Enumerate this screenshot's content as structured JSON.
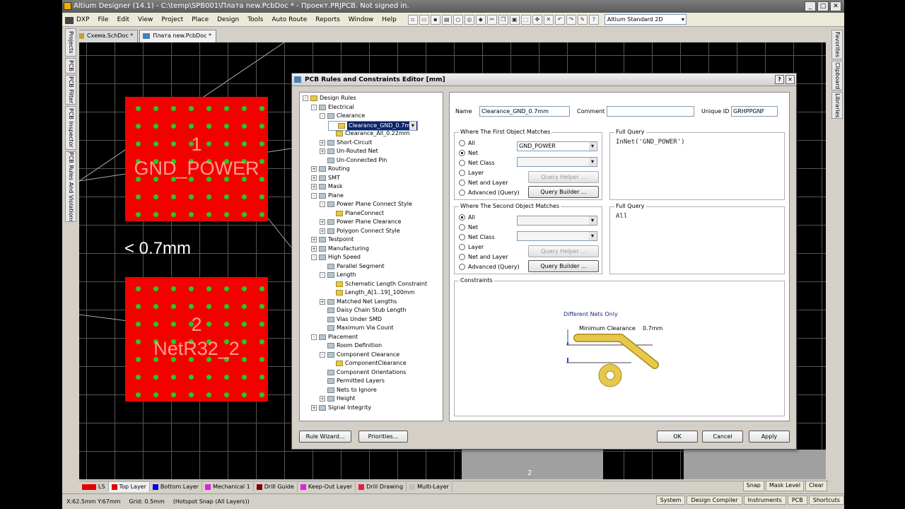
{
  "window": {
    "title": "Altium Designer (14.1) - C:\\temp\\SPB001\\Плата new.PcbDoc * - Проект.PRJPCB. Not signed in.",
    "min": "_",
    "max": "□",
    "close": "✕"
  },
  "menu": [
    "DXP",
    "File",
    "Edit",
    "View",
    "Project",
    "Place",
    "Design",
    "Tools",
    "Auto Route",
    "Reports",
    "Window",
    "Help"
  ],
  "view_select": "Altium Standard 2D",
  "doc_tabs": [
    "Схема.SchDoc *",
    "Плата new.PcbDoc *"
  ],
  "left_panels": [
    "Projects",
    "PCB",
    "PCB Filter",
    "PCB Inspector",
    "PCB Rules And Violations"
  ],
  "right_panels": [
    "Favorites",
    "Clipboard",
    "Libraries"
  ],
  "canvas": {
    "pad1_num": "1",
    "pad1_net": "GND_POWER",
    "pad2_num": "2",
    "pad2_net": "NetR32_2",
    "dim_text": "< 0.7mm",
    "bottom_num": "2"
  },
  "layers": [
    {
      "name": "LS",
      "color": "#e00000"
    },
    {
      "name": "Top Layer",
      "color": "#e00000"
    },
    {
      "name": "Bottom Layer",
      "color": "#0000e0"
    },
    {
      "name": "Mechanical 1",
      "color": "#e020e0"
    },
    {
      "name": "Drill Guide",
      "color": "#800000"
    },
    {
      "name": "Keep-Out Layer",
      "color": "#e020e0"
    },
    {
      "name": "Drill Drawing",
      "color": "#e02040"
    },
    {
      "name": "Multi-Layer",
      "color": "#c0c0c0"
    }
  ],
  "snap": {
    "snap": "Snap",
    "mask": "Mask Level",
    "clear": "Clear"
  },
  "status": {
    "coords": "X:62.5mm Y:67mm",
    "grid": "Grid: 0.5mm",
    "hotspot": "(Hotspot Snap (All Layers))",
    "buttons": [
      "System",
      "Design Compiler",
      "Instruments",
      "PCB",
      "Shortcuts"
    ]
  },
  "dialog": {
    "title": "PCB Rules and Constraints Editor [mm]",
    "help": "?",
    "close": "✕",
    "tree": [
      {
        "label": "Design Rules",
        "level": 0,
        "ex": "-"
      },
      {
        "label": "Electrical",
        "level": 1,
        "ex": "-"
      },
      {
        "label": "Clearance",
        "level": 2,
        "ex": "-"
      },
      {
        "label": "Clearance_GND_0.7mm",
        "level": 3,
        "ex": "",
        "selected": true
      },
      {
        "label": "Clearance_All_0.22mm",
        "level": 3,
        "ex": ""
      },
      {
        "label": "Short-Circuit",
        "level": 2,
        "ex": "+"
      },
      {
        "label": "Un-Routed Net",
        "level": 2,
        "ex": "+"
      },
      {
        "label": "Un-Connected Pin",
        "level": 2,
        "ex": ""
      },
      {
        "label": "Routing",
        "level": 1,
        "ex": "+"
      },
      {
        "label": "SMT",
        "level": 1,
        "ex": "+"
      },
      {
        "label": "Mask",
        "level": 1,
        "ex": "+"
      },
      {
        "label": "Plane",
        "level": 1,
        "ex": "-"
      },
      {
        "label": "Power Plane Connect Style",
        "level": 2,
        "ex": "-"
      },
      {
        "label": "PlaneConnect",
        "level": 3,
        "ex": ""
      },
      {
        "label": "Power Plane Clearance",
        "level": 2,
        "ex": "+"
      },
      {
        "label": "Polygon Connect Style",
        "level": 2,
        "ex": "+"
      },
      {
        "label": "Testpoint",
        "level": 1,
        "ex": "+"
      },
      {
        "label": "Manufacturing",
        "level": 1,
        "ex": "+"
      },
      {
        "label": "High Speed",
        "level": 1,
        "ex": "-"
      },
      {
        "label": "Parallel Segment",
        "level": 2,
        "ex": ""
      },
      {
        "label": "Length",
        "level": 2,
        "ex": "-"
      },
      {
        "label": "Schematic Length Constraint",
        "level": 3,
        "ex": ""
      },
      {
        "label": "Length_A[1..19]_100mm",
        "level": 3,
        "ex": ""
      },
      {
        "label": "Matched Net Lengths",
        "level": 2,
        "ex": "+"
      },
      {
        "label": "Daisy Chain Stub Length",
        "level": 2,
        "ex": ""
      },
      {
        "label": "Vias Under SMD",
        "level": 2,
        "ex": ""
      },
      {
        "label": "Maximum Via Count",
        "level": 2,
        "ex": ""
      },
      {
        "label": "Placement",
        "level": 1,
        "ex": "-"
      },
      {
        "label": "Room Definition",
        "level": 2,
        "ex": ""
      },
      {
        "label": "Component Clearance",
        "level": 2,
        "ex": "-"
      },
      {
        "label": "ComponentClearance",
        "level": 3,
        "ex": ""
      },
      {
        "label": "Component Orientations",
        "level": 2,
        "ex": ""
      },
      {
        "label": "Permitted Layers",
        "level": 2,
        "ex": ""
      },
      {
        "label": "Nets to Ignore",
        "level": 2,
        "ex": ""
      },
      {
        "label": "Height",
        "level": 2,
        "ex": "+"
      },
      {
        "label": "Signal Integrity",
        "level": 1,
        "ex": "+"
      }
    ],
    "name_label": "Name",
    "name_value": "Clearance_GND_0.7mm",
    "comment_label": "Comment",
    "comment_value": "",
    "uid_label": "Unique ID",
    "uid_value": "GRHPPGNF",
    "first": {
      "title": "Where The First Object Matches",
      "options": [
        "All",
        "Net",
        "Net Class",
        "Layer",
        "Net and Layer",
        "Advanced (Query)"
      ],
      "selected": 1,
      "net_value": "GND_POWER",
      "query_helper": "Query Helper ...",
      "query_builder": "Query Builder ...",
      "full_query_title": "Full Query",
      "full_query": "InNet('GND_POWER')"
    },
    "second": {
      "title": "Where The Second Object Matches",
      "options": [
        "All",
        "Net",
        "Net Class",
        "Layer",
        "Net and Layer",
        "Advanced (Query)"
      ],
      "selected": 0,
      "query_helper": "Query Helper ...",
      "query_builder": "Query Builder ...",
      "full_query_title": "Full Query",
      "full_query": "All"
    },
    "constraints": {
      "title": "Constraints",
      "diff_nets": "Different Nets Only",
      "min_clear_label": "Minimum Clearance",
      "min_clear_value": "0.7mm"
    },
    "buttons": {
      "rule_wizard": "Rule Wizard...",
      "priorities": "Priorities...",
      "ok": "OK",
      "cancel": "Cancel",
      "apply": "Apply"
    }
  }
}
